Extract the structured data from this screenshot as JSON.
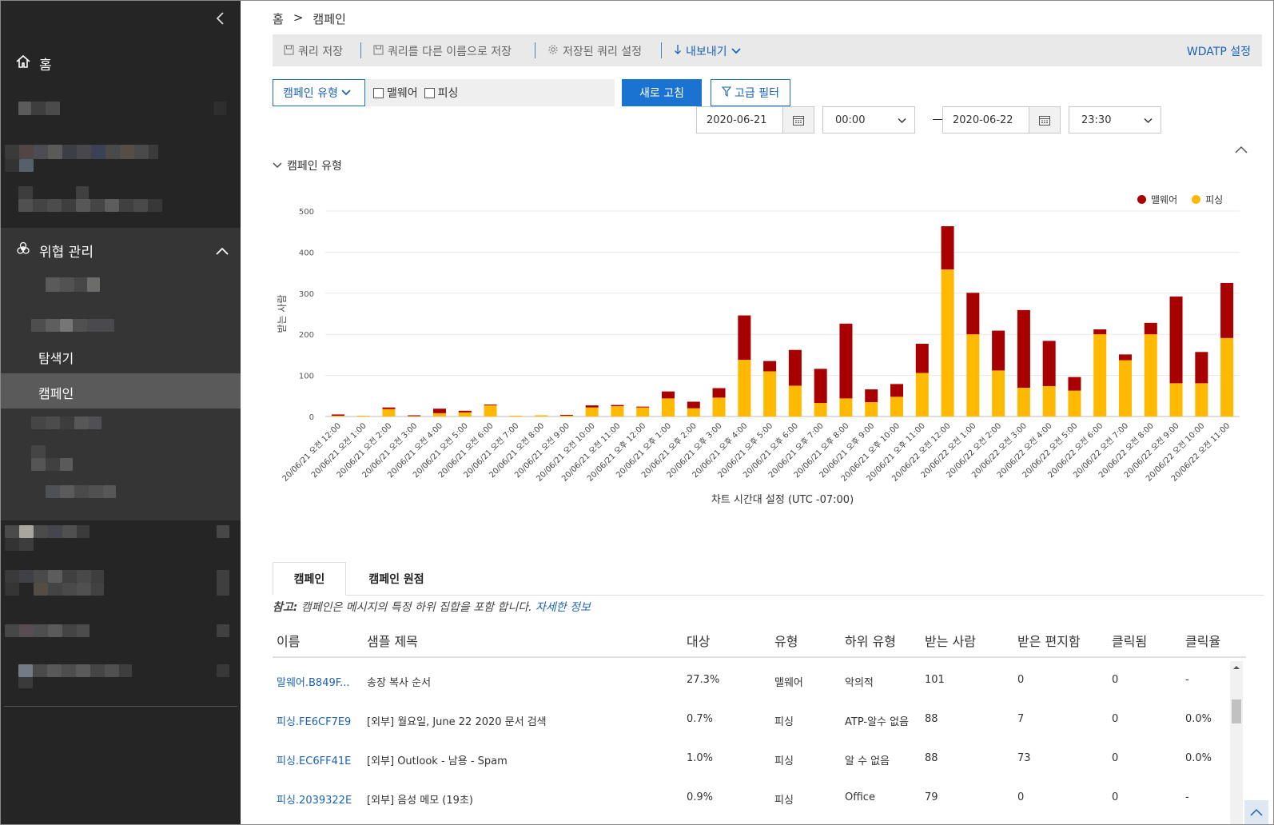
{
  "sidebar": {
    "home_label": "홈",
    "threat_label": "위협 관리",
    "explorer_label": "탐색기",
    "campaigns_label": "캠페인"
  },
  "breadcrumb": {
    "home": "홈",
    "sep": ">",
    "current": "캠페인"
  },
  "toolbar": {
    "save_query": "쿼리 저장",
    "save_query_as": "쿼리를 다른 이름으로 저장",
    "saved_query_settings": "저장된 쿼리 설정",
    "export": "내보내기",
    "wdatp_settings": "WDATP 설정"
  },
  "filters": {
    "campaign_type": "캠페인 유형",
    "malware": "맬웨어",
    "phish": "피싱",
    "refresh": "새로 고침",
    "advanced_filter": "고급 필터",
    "start_date": "2020-06-21",
    "start_time": "00:00",
    "end_date": "2020-06-22",
    "end_time": "23:30"
  },
  "section_title": "캠페인 유형",
  "chart_data": {
    "type": "bar",
    "stacked": true,
    "ylabel": "받는 사람",
    "xlabel": "차트 시간대 설정 (UTC -07:00)",
    "ylim": [
      0,
      500
    ],
    "yticks": [
      0,
      100,
      200,
      300,
      400,
      500
    ],
    "categories": [
      "20/06/21 오전 12:00",
      "20/06/21 오전 1:00",
      "20/06/21 오전 2:00",
      "20/06/21 오전 3:00",
      "20/06/21 오전 4:00",
      "20/06/21 오전 5:00",
      "20/06/21 오전 6:00",
      "20/06/21 오전 7:00",
      "20/06/21 오전 8:00",
      "20/06/21 오전 9:00",
      "20/06/21 오전 10:00",
      "20/06/21 오전 11:00",
      "20/06/21 오후 12:00",
      "20/06/21 오후 1:00",
      "20/06/21 오후 2:00",
      "20/06/21 오후 3:00",
      "20/06/21 오후 4:00",
      "20/06/21 오후 5:00",
      "20/06/21 오후 6:00",
      "20/06/21 오후 7:00",
      "20/06/21 오후 8:00",
      "20/06/21 오후 9:00",
      "20/06/21 오후 10:00",
      "20/06/21 오후 11:00",
      "20/06/22 오전 12:00",
      "20/06/22 오전 1:00",
      "20/06/22 오전 2:00",
      "20/06/22 오전 3:00",
      "20/06/22 오전 4:00",
      "20/06/22 오전 5:00",
      "20/06/22 오전 6:00",
      "20/06/22 오전 7:00",
      "20/06/22 오전 8:00",
      "20/06/22 오전 9:00",
      "20/06/22 오전 10:00",
      "20/06/22 오전 11:00"
    ],
    "series": [
      {
        "name": "피싱",
        "color": "#FFB900",
        "values": [
          2,
          2,
          18,
          1,
          8,
          10,
          27,
          2,
          3,
          2,
          22,
          25,
          22,
          44,
          20,
          46,
          138,
          110,
          75,
          33,
          44,
          35,
          48,
          106,
          358,
          200,
          112,
          70,
          74,
          63,
          200,
          137,
          200,
          81,
          81,
          191
        ]
      },
      {
        "name": "맬웨어",
        "color": "#A80000",
        "values": [
          3,
          0,
          4,
          2,
          11,
          4,
          2,
          0,
          0,
          2,
          5,
          3,
          2,
          17,
          16,
          23,
          108,
          25,
          87,
          83,
          182,
          31,
          31,
          71,
          105,
          101,
          97,
          189,
          110,
          33,
          12,
          14,
          28,
          211,
          76,
          134
        ]
      }
    ]
  },
  "tabs": [
    "캠페인",
    "캠페인 원점"
  ],
  "note": {
    "prefix": "참고:",
    "text": " 캠페인은 메시지의 특정 하위 집합을 포함 합니다. ",
    "link": "자세한 정보"
  },
  "table": {
    "headers": [
      "이름",
      "샘플 제목",
      "대상",
      "유형",
      "하위 유형",
      "받는 사람",
      "받은 편지함",
      "클릭됨",
      "클릭율"
    ],
    "rows": [
      [
        "말웨어.B849F...",
        "송장 복사 순서",
        "27.3%",
        "맬웨어",
        "악의적",
        "101",
        "0",
        "0",
        "-"
      ],
      [
        "피싱.FE6CF7E9",
        "[외부] 월요일, June 22 2020 문서 검색",
        "0.7%",
        "피싱",
        "ATP-알수 없음",
        "88",
        "7",
        "0",
        "0.0%"
      ],
      [
        "피싱.EC6FF41E",
        "[외부] Outlook - 남용 - Spam",
        "1.0%",
        "피싱",
        "알 수 없음",
        "88",
        "73",
        "0",
        "0.0%"
      ],
      [
        "피싱.2039322E",
        "[외부] 음성 메모 (19초)",
        "0.9%",
        "피싱",
        "Office",
        "79",
        "0",
        "0",
        "-"
      ]
    ]
  }
}
